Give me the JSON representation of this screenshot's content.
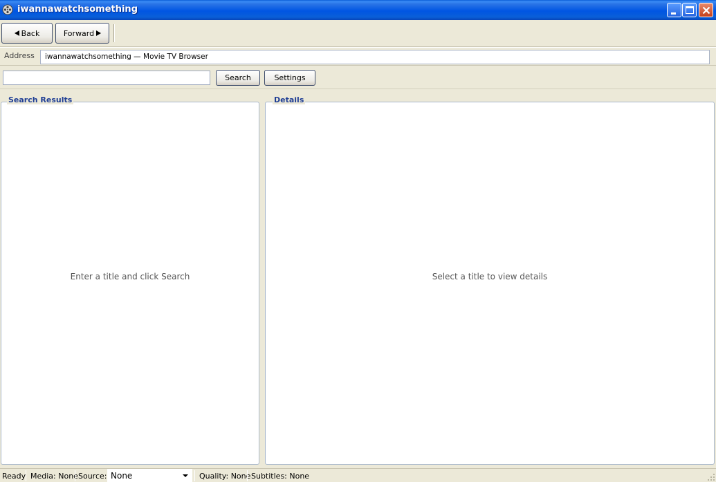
{
  "window": {
    "title": "iwannawatchsomething",
    "icon": "film-reel-icon"
  },
  "toolbar": {
    "back_label": "Back",
    "forward_label": "Forward"
  },
  "address": {
    "label": "Address",
    "value": "iwannawatchsomething — Movie  TV Browser"
  },
  "search": {
    "value": "",
    "button_label": "Search",
    "settings_label": "Settings"
  },
  "results": {
    "title": "Search Results",
    "placeholder": "Enter a title and click Search"
  },
  "details": {
    "title": "Details",
    "placeholder": "Select a title to view details"
  },
  "status": {
    "state": "Ready",
    "media": "Media: None",
    "source_label": "Source:",
    "source_value": "None",
    "quality": "Quality: None",
    "subtitles": "Subtitles: None"
  },
  "colors": {
    "titlebar": "#0055e3",
    "legend_text": "#1f3e94",
    "panel_border": "#a8b7cc",
    "chrome": "#ece9d8"
  }
}
